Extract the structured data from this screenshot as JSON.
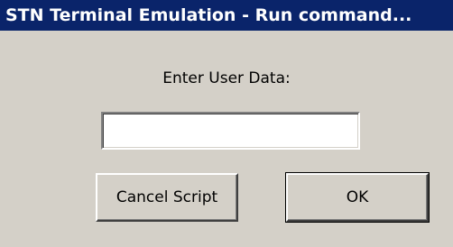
{
  "window": {
    "title": "STN Terminal Emulation - Run command..."
  },
  "form": {
    "prompt_label": "Enter User Data:",
    "input_value": ""
  },
  "buttons": {
    "cancel_label": "Cancel Script",
    "ok_label": "OK"
  },
  "colors": {
    "titlebar": "#0a246a",
    "dialog_bg": "#d4d0c8"
  }
}
